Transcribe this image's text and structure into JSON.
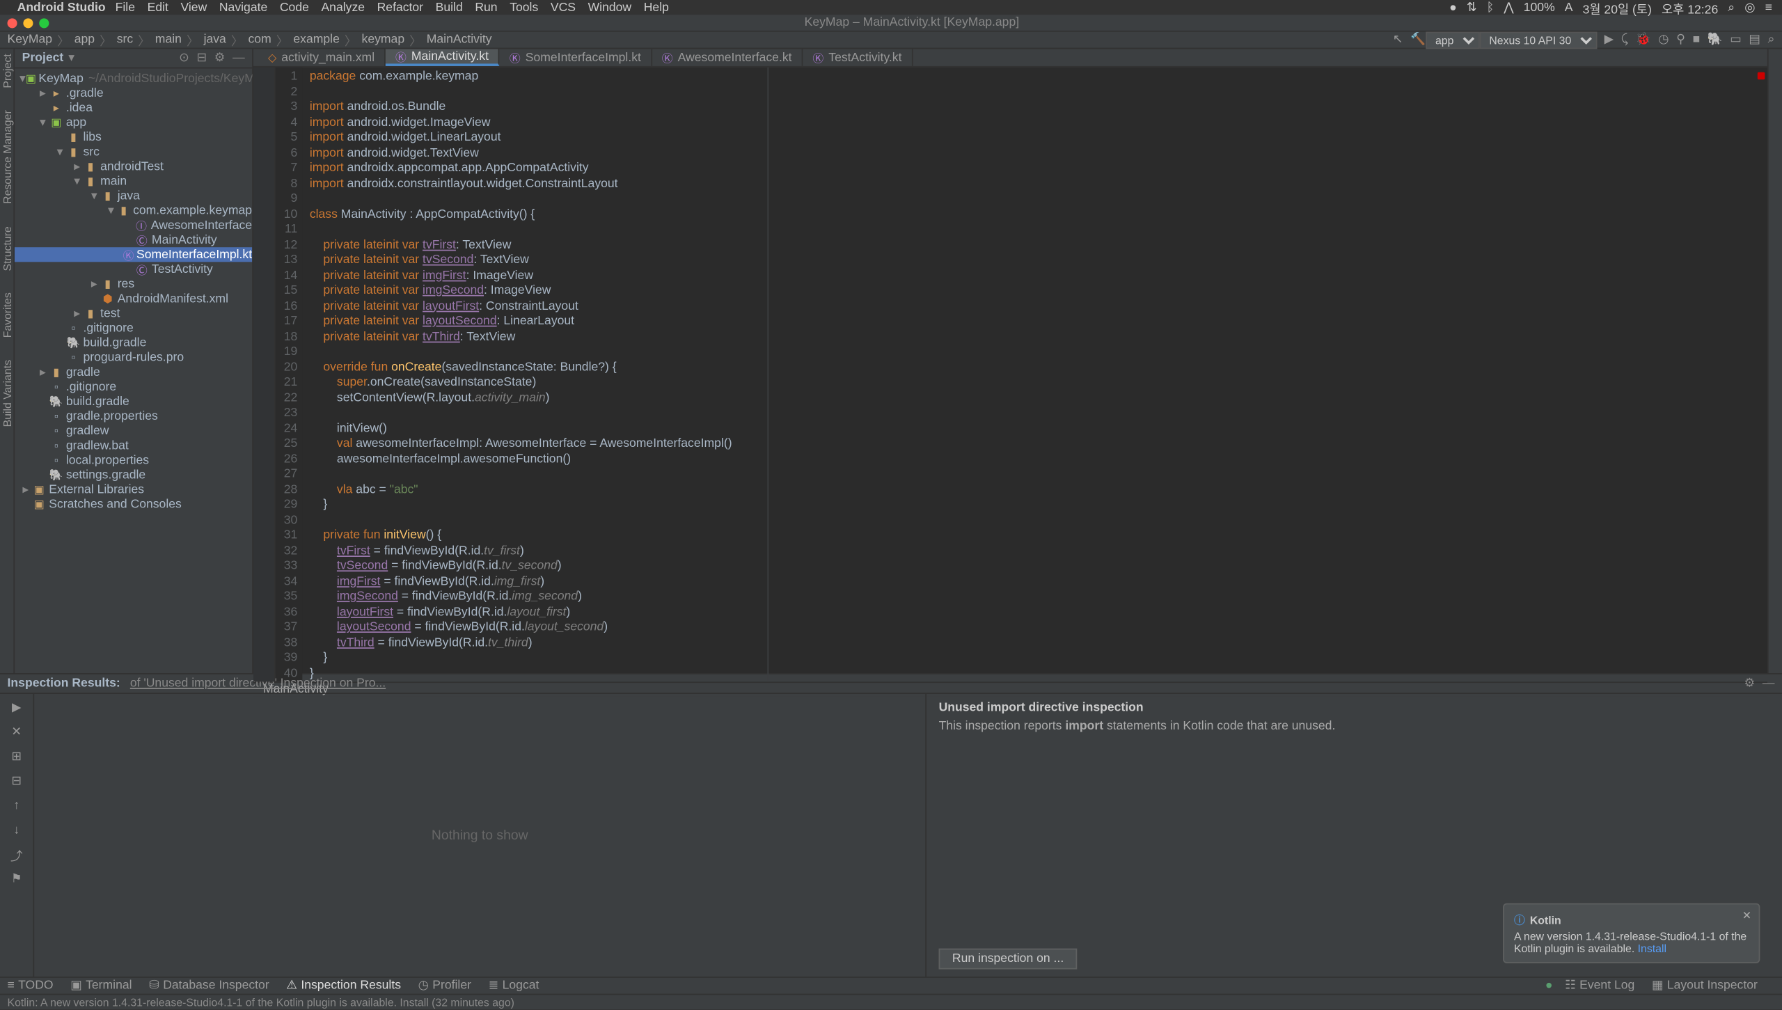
{
  "mac_menu": {
    "app": "Android Studio",
    "items": [
      "File",
      "Edit",
      "View",
      "Navigate",
      "Code",
      "Analyze",
      "Refactor",
      "Build",
      "Run",
      "Tools",
      "VCS",
      "Window",
      "Help"
    ],
    "status_battery": "100%",
    "status_date": "3월 20일 (토)",
    "status_time": "오후 12:26",
    "status_lang": "A"
  },
  "window_title": "KeyMap – MainActivity.kt [KeyMap.app]",
  "breadcrumb": [
    "KeyMap",
    "app",
    "src",
    "main",
    "java",
    "com",
    "example",
    "keymap",
    "MainActivity"
  ],
  "run_config": "app",
  "device": "Nexus 10 API 30",
  "project_panel_title": "Project",
  "project_root": "KeyMap",
  "project_root_hint": "~/AndroidStudioProjects/KeyMap",
  "tree": {
    "gradle_dir": ".gradle",
    "idea_dir": ".idea",
    "app": "app",
    "libs": "libs",
    "src": "src",
    "androidTest": "androidTest",
    "main": "main",
    "java": "java",
    "pkg": "com.example.keymap",
    "awesome_iface": "AwesomeInterface",
    "main_activity": "MainActivity",
    "some_impl": "SomeInterfaceImpl.kt",
    "test_activity": "TestActivity",
    "res": "res",
    "manifest": "AndroidManifest.xml",
    "test": "test",
    "gitignore": ".gitignore",
    "build_gradle": "build.gradle",
    "proguard": "proguard-rules.pro",
    "gradle_dir2": "gradle",
    "gitignore2": ".gitignore",
    "build_gradle2": "build.gradle",
    "gradle_props": "gradle.properties",
    "gradlew": "gradlew",
    "gradlew_bat": "gradlew.bat",
    "local_props": "local.properties",
    "settings_gradle": "settings.gradle",
    "ext_libs": "External Libraries",
    "scratches": "Scratches and Consoles"
  },
  "tabs": [
    {
      "label": "activity_main.xml",
      "icon": "xml"
    },
    {
      "label": "MainActivity.kt",
      "icon": "kt",
      "active": true
    },
    {
      "label": "SomeInterfaceImpl.kt",
      "icon": "kt"
    },
    {
      "label": "AwesomeInterface.kt",
      "icon": "kt"
    },
    {
      "label": "TestActivity.kt",
      "icon": "kt"
    }
  ],
  "editor_breadcrumb": "MainActivity",
  "code_lines": [
    [
      [
        "package ",
        "kw"
      ],
      [
        "com.example.keymap",
        ""
      ]
    ],
    [],
    [
      [
        "import ",
        "kw"
      ],
      [
        "android.os.Bundle",
        ""
      ]
    ],
    [
      [
        "import ",
        "kw"
      ],
      [
        "android.widget.ImageView",
        ""
      ]
    ],
    [
      [
        "import ",
        "kw"
      ],
      [
        "android.widget.LinearLayout",
        ""
      ]
    ],
    [
      [
        "import ",
        "kw"
      ],
      [
        "android.widget.TextView",
        ""
      ]
    ],
    [
      [
        "import ",
        "kw"
      ],
      [
        "androidx.appcompat.app.AppCompatActivity",
        ""
      ]
    ],
    [
      [
        "import ",
        "kw"
      ],
      [
        "androidx.constraintlayout.widget.ConstraintLayout",
        ""
      ]
    ],
    [],
    [
      [
        "class ",
        "kw"
      ],
      [
        "MainActivity : AppCompatActivity() {",
        ""
      ]
    ],
    [],
    [
      [
        "    private lateinit var ",
        "kw"
      ],
      [
        "tvFirst",
        "prop"
      ],
      [
        ": TextView",
        ""
      ]
    ],
    [
      [
        "    private lateinit var ",
        "kw"
      ],
      [
        "tvSecond",
        "prop"
      ],
      [
        ": TextView",
        ""
      ]
    ],
    [
      [
        "    private lateinit var ",
        "kw"
      ],
      [
        "imgFirst",
        "prop"
      ],
      [
        ": ImageView",
        ""
      ]
    ],
    [
      [
        "    private lateinit var ",
        "kw"
      ],
      [
        "imgSecond",
        "prop"
      ],
      [
        ": ImageView",
        ""
      ]
    ],
    [
      [
        "    private lateinit var ",
        "kw"
      ],
      [
        "layoutFirst",
        "prop"
      ],
      [
        ": ConstraintLayout",
        ""
      ]
    ],
    [
      [
        "    private lateinit var ",
        "kw"
      ],
      [
        "layoutSecond",
        "prop"
      ],
      [
        ": LinearLayout",
        ""
      ]
    ],
    [
      [
        "    private lateinit var ",
        "kw"
      ],
      [
        "tvThird",
        "prop"
      ],
      [
        ": TextView",
        ""
      ]
    ],
    [],
    [
      [
        "    override fun ",
        "kw"
      ],
      [
        "onCreate",
        "fn"
      ],
      [
        "(savedInstanceState: Bundle?) {",
        ""
      ]
    ],
    [
      [
        "        super",
        "kw"
      ],
      [
        ".onCreate(savedInstanceState)",
        ""
      ]
    ],
    [
      [
        "        setContentView(R.layout.",
        ""
      ],
      [
        "activity_main",
        "param"
      ],
      [
        ")",
        ""
      ]
    ],
    [],
    [
      [
        "        initView()",
        ""
      ]
    ],
    [
      [
        "        ",
        ""
      ],
      [
        "val ",
        "kw"
      ],
      [
        "awesomeInterfaceImpl: AwesomeInterface = AwesomeInterfaceImpl()",
        ""
      ]
    ],
    [
      [
        "        awesomeInterfaceImpl.awesomeFunction()",
        ""
      ]
    ],
    [],
    [
      [
        "        ",
        ""
      ],
      [
        "vla ",
        "kw"
      ],
      [
        "abc = ",
        ""
      ],
      [
        "\"abc\"",
        "str"
      ]
    ],
    [
      [
        "    }",
        ""
      ]
    ],
    [],
    [
      [
        "    private fun ",
        "kw"
      ],
      [
        "initView",
        "fn"
      ],
      [
        "() {",
        ""
      ]
    ],
    [
      [
        "        ",
        ""
      ],
      [
        "tvFirst",
        "prop"
      ],
      [
        " = findViewById(R.id.",
        ""
      ],
      [
        "tv_first",
        "param"
      ],
      [
        ")",
        ""
      ]
    ],
    [
      [
        "        ",
        ""
      ],
      [
        "tvSecond",
        "prop"
      ],
      [
        " = findViewById(R.id.",
        ""
      ],
      [
        "tv_second",
        "param"
      ],
      [
        ")",
        ""
      ]
    ],
    [
      [
        "        ",
        ""
      ],
      [
        "imgFirst",
        "prop"
      ],
      [
        " = findViewById(R.id.",
        ""
      ],
      [
        "img_first",
        "param"
      ],
      [
        ")",
        ""
      ]
    ],
    [
      [
        "        ",
        ""
      ],
      [
        "imgSecond",
        "prop"
      ],
      [
        " = findViewById(R.id.",
        ""
      ],
      [
        "img_second",
        "param"
      ],
      [
        ")",
        ""
      ]
    ],
    [
      [
        "        ",
        ""
      ],
      [
        "layoutFirst",
        "prop"
      ],
      [
        " = findViewById(R.id.",
        ""
      ],
      [
        "layout_first",
        "param"
      ],
      [
        ")",
        ""
      ]
    ],
    [
      [
        "        ",
        ""
      ],
      [
        "layoutSecond",
        "prop"
      ],
      [
        " = findViewById(R.id.",
        ""
      ],
      [
        "layout_second",
        "param"
      ],
      [
        ")",
        ""
      ]
    ],
    [
      [
        "        ",
        ""
      ],
      [
        "tvThird",
        "prop"
      ],
      [
        " = findViewById(R.id.",
        ""
      ],
      [
        "tv_third",
        "param"
      ],
      [
        ")",
        ""
      ]
    ],
    [
      [
        "    }",
        ""
      ]
    ],
    [
      [
        "}",
        ""
      ]
    ]
  ],
  "inspection": {
    "title": "Inspection Results:",
    "subtitle": "of 'Unused import directive' Inspection on Pro...",
    "empty": "Nothing to show",
    "detail_title": "Unused import directive inspection",
    "detail_body_pre": "This inspection reports ",
    "detail_body_bold": "import",
    "detail_body_post": " statements in Kotlin code that are unused.",
    "run_button": "Run inspection on ..."
  },
  "bottom_tabs": {
    "todo": "TODO",
    "terminal": "Terminal",
    "db": "Database Inspector",
    "insp": "Inspection Results",
    "profiler": "Profiler",
    "logcat": "Logcat",
    "event_log": "Event Log",
    "layout_insp": "Layout Inspector"
  },
  "status_message": "Kotlin: A new version 1.4.31-release-Studio4.1-1 of the Kotlin plugin is available. Install (32 minutes ago)",
  "left_tool_tabs": [
    "Project",
    "Resource Manager",
    "Structure",
    "Favorites",
    "Build Variants"
  ],
  "notification": {
    "title": "Kotlin",
    "body": "A new version 1.4.31-release-Studio4.1-1 of the Kotlin plugin is available.",
    "link": "Install"
  }
}
